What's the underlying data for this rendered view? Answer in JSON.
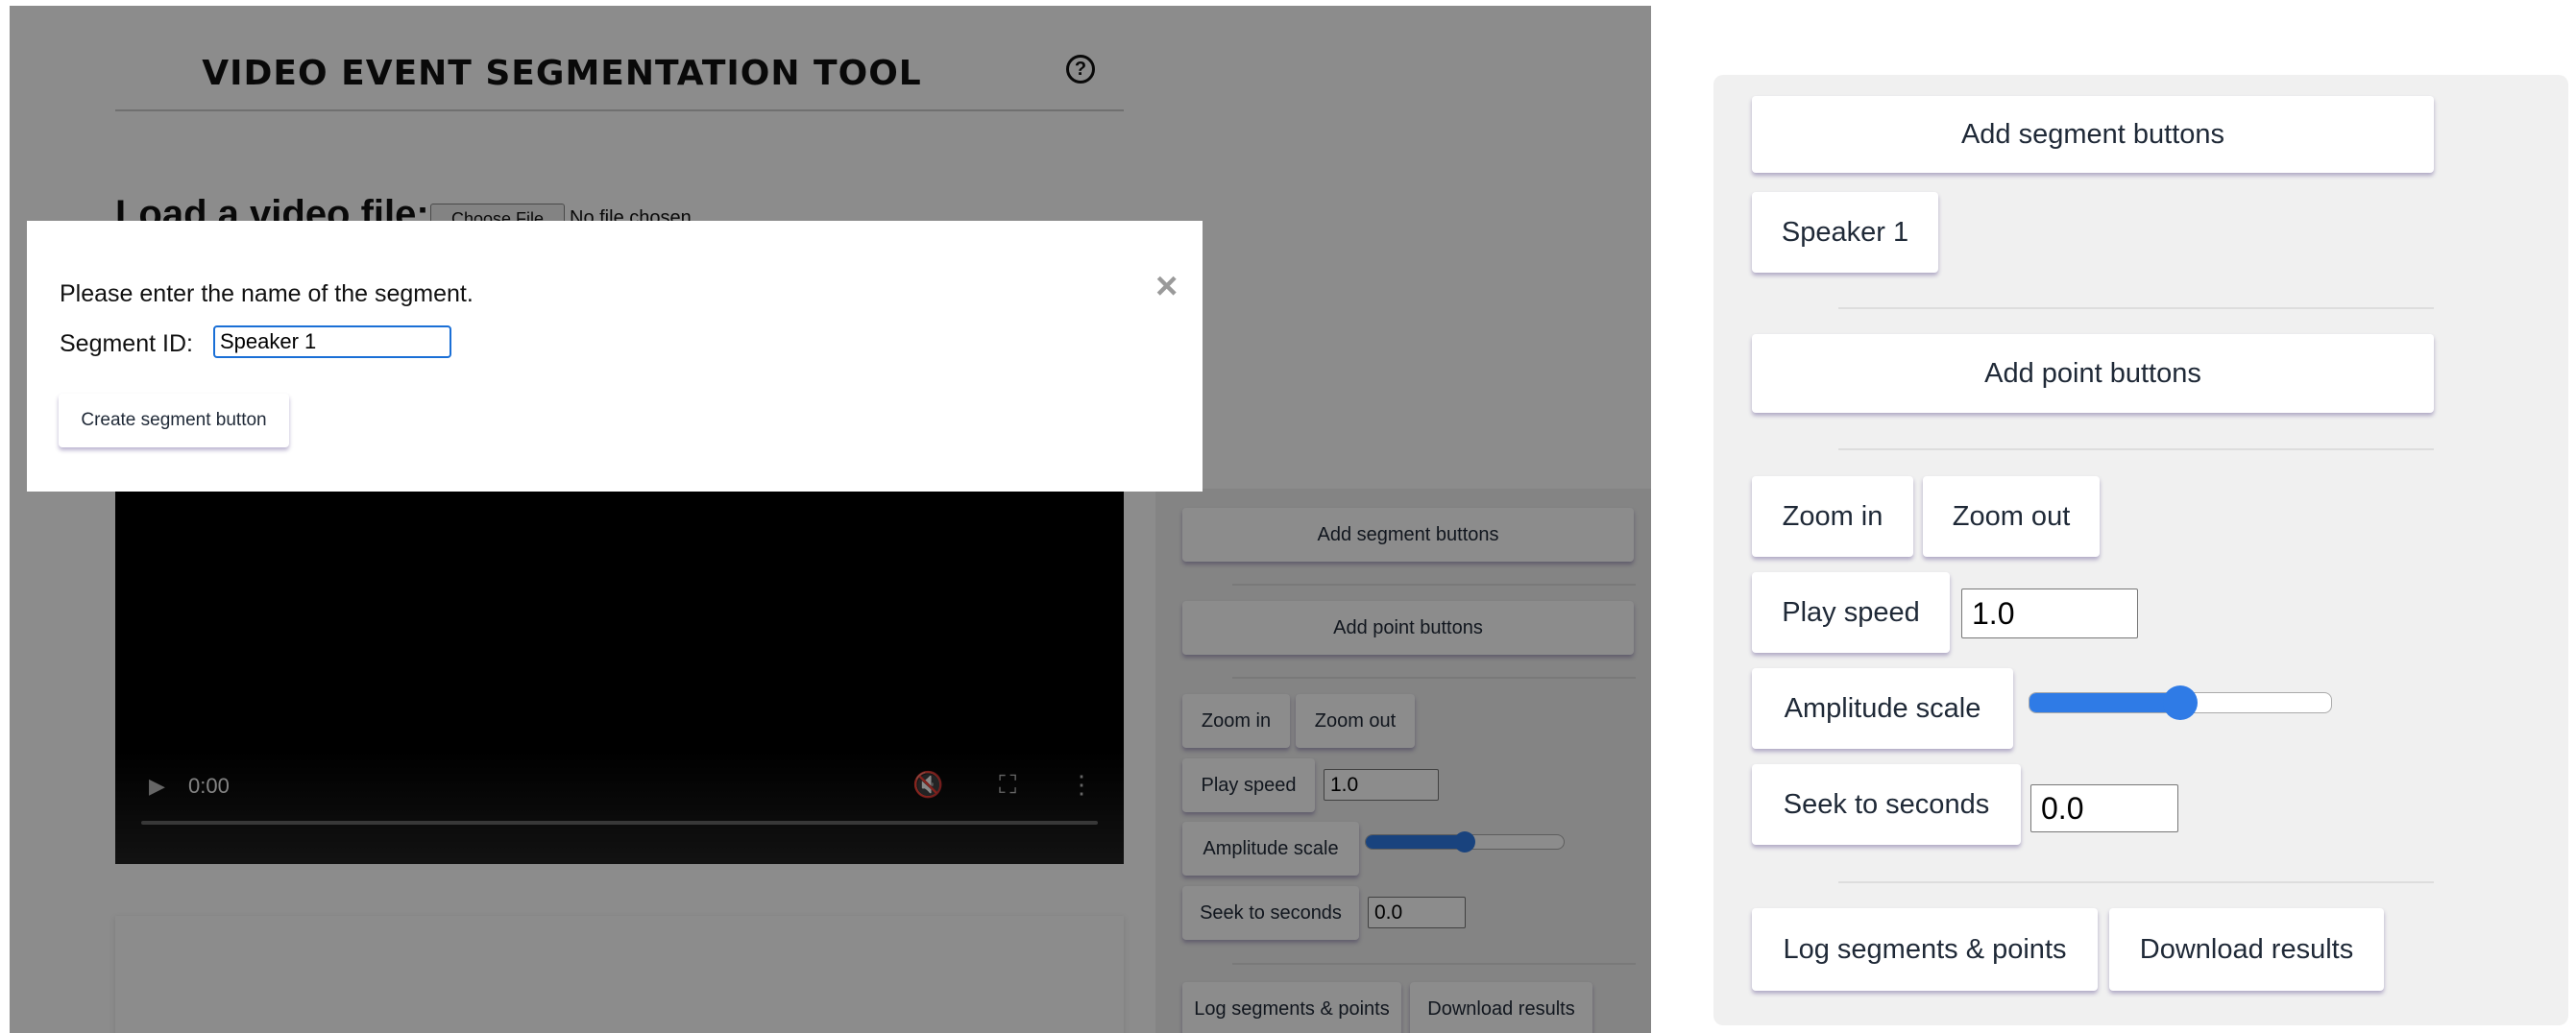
{
  "left": {
    "title": "VIDEO EVENT SEGMENTATION TOOL",
    "help_icon": "?",
    "load_label": "Load a video file:",
    "file_button": "Choose File",
    "file_status": "No file chosen",
    "video": {
      "time": "0:00",
      "play_icon": "▶",
      "mute_icon": "🔇",
      "fullscreen_icon": "⛶",
      "more_icon": "⋮"
    },
    "modal": {
      "message": "Please enter the name of the segment.",
      "segment_label": "Segment ID:",
      "segment_value": "Speaker 1",
      "create_button": "Create segment button",
      "close_icon": "×"
    },
    "panel": {
      "add_segment": "Add segment buttons",
      "add_point": "Add point buttons",
      "zoom_in": "Zoom in",
      "zoom_out": "Zoom out",
      "play_speed": "Play speed",
      "play_speed_value": "1.0",
      "amplitude": "Amplitude scale",
      "amplitude_level": 0.5,
      "seek": "Seek to seconds",
      "seek_value": "0.0",
      "log": "Log segments & points",
      "download": "Download results"
    }
  },
  "right": {
    "add_segment": "Add segment buttons",
    "speaker_button": "Speaker 1",
    "add_point": "Add point buttons",
    "zoom_in": "Zoom in",
    "zoom_out": "Zoom out",
    "play_speed": "Play speed",
    "play_speed_value": "1.0",
    "amplitude": "Amplitude scale",
    "amplitude_level": 0.5,
    "seek": "Seek to seconds",
    "seek_value": "0.0",
    "log": "Log segments & points",
    "download": "Download results"
  },
  "colors": {
    "accent": "#2f7be6",
    "focus": "#1a6fd6",
    "panel_bg": "#f0f0f0",
    "overlay": "rgba(0,0,0,0.45)"
  }
}
